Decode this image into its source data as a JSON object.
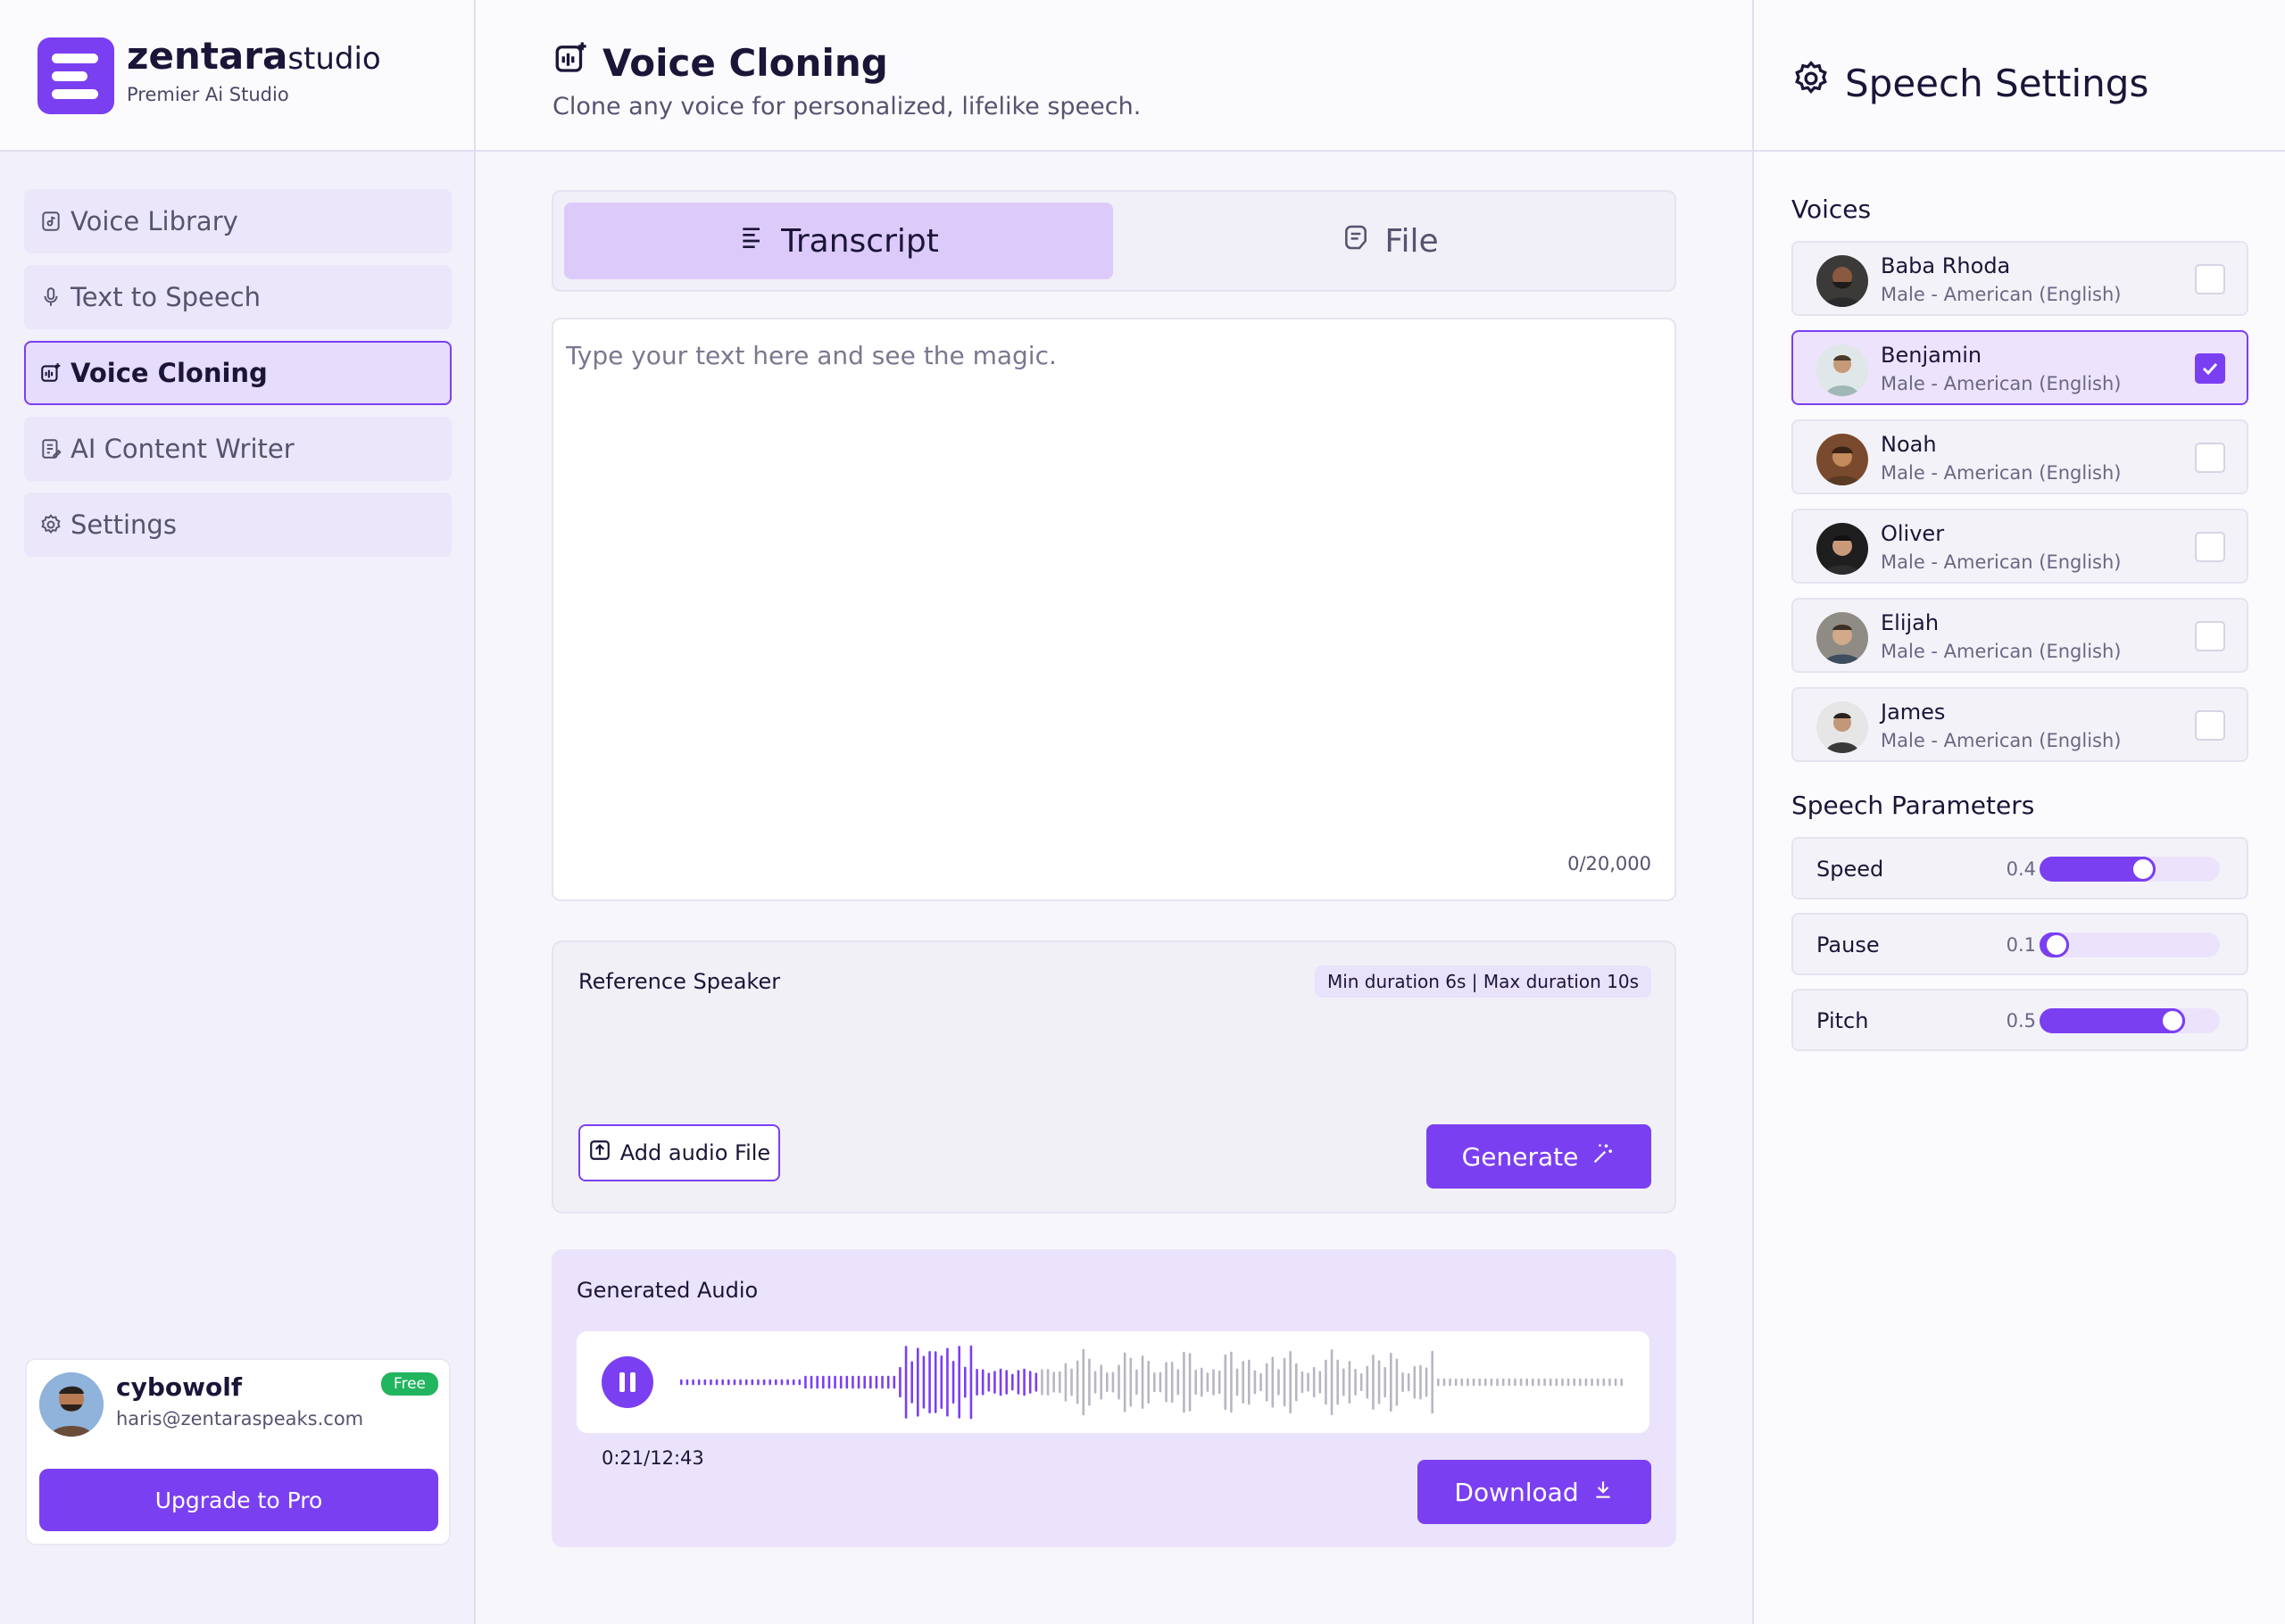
{
  "brand": {
    "name": "zentara",
    "suffix": "studio",
    "tagline": "Premier Ai Studio"
  },
  "nav": [
    {
      "label": "Voice Library",
      "icon": "music-file-icon",
      "active": false
    },
    {
      "label": "Text to Speech",
      "icon": "mic-icon",
      "active": false
    },
    {
      "label": "Voice Cloning",
      "icon": "voice-clone-icon",
      "active": true
    },
    {
      "label": "AI Content Writer",
      "icon": "document-edit-icon",
      "active": false
    },
    {
      "label": "Settings",
      "icon": "gear-icon",
      "active": false
    }
  ],
  "user": {
    "name": "cybowolf",
    "email": "haris@zentaraspeaks.com",
    "plan_badge": "Free",
    "upgrade_label": "Upgrade to Pro"
  },
  "page": {
    "title": "Voice Cloning",
    "subtitle": "Clone any voice for personalized, lifelike speech."
  },
  "tabs": [
    {
      "label": "Transcript",
      "active": true
    },
    {
      "label": "File",
      "active": false
    }
  ],
  "editor": {
    "placeholder": "Type your text here and see the magic.",
    "value": "",
    "counter": "0/20,000"
  },
  "reference": {
    "title": "Reference Speaker",
    "duration_note": "Min duration 6s | Max duration 10s",
    "add_label": "Add audio File",
    "generate_label": "Generate"
  },
  "generated": {
    "title": "Generated Audio",
    "time": "0:21/12:43",
    "download_label": "Download",
    "played_fraction": 0.38
  },
  "right": {
    "title": "Speech Settings",
    "voices_title": "Voices",
    "voices": [
      {
        "name": "Baba Rhoda",
        "desc": "Male - American (English)",
        "selected": false
      },
      {
        "name": "Benjamin",
        "desc": "Male - American (English)",
        "selected": true
      },
      {
        "name": "Noah",
        "desc": "Male - American (English)",
        "selected": false
      },
      {
        "name": "Oliver",
        "desc": "Male - American (English)",
        "selected": false
      },
      {
        "name": "Elijah",
        "desc": "Male - American (English)",
        "selected": false
      },
      {
        "name": "James",
        "desc": "Male - American (English)",
        "selected": false
      }
    ],
    "params_title": "Speech Parameters",
    "params": [
      {
        "name": "Speed",
        "value": "0.4",
        "level": 0.4
      },
      {
        "name": "Pause",
        "value": "0.1",
        "level": 0.1
      },
      {
        "name": "Pitch",
        "value": "0.5",
        "level": 0.5
      }
    ]
  },
  "colors": {
    "accent": "#7b3ff2",
    "accent_soft": "#ebe3fb",
    "free_badge": "#22b560"
  }
}
